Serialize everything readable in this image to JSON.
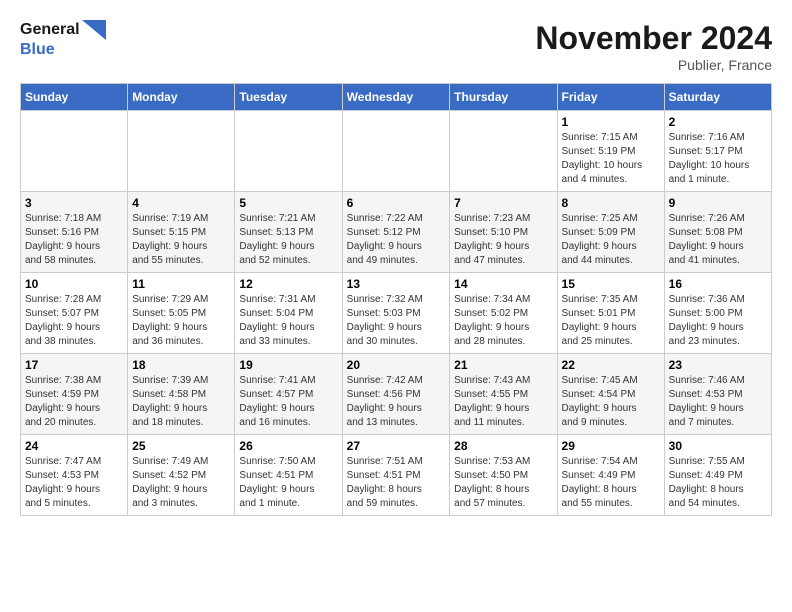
{
  "logo": {
    "line1": "General",
    "line2": "Blue"
  },
  "title": "November 2024",
  "location": "Publier, France",
  "weekdays": [
    "Sunday",
    "Monday",
    "Tuesday",
    "Wednesday",
    "Thursday",
    "Friday",
    "Saturday"
  ],
  "weeks": [
    [
      {
        "day": "",
        "info": ""
      },
      {
        "day": "",
        "info": ""
      },
      {
        "day": "",
        "info": ""
      },
      {
        "day": "",
        "info": ""
      },
      {
        "day": "",
        "info": ""
      },
      {
        "day": "1",
        "info": "Sunrise: 7:15 AM\nSunset: 5:19 PM\nDaylight: 10 hours\nand 4 minutes."
      },
      {
        "day": "2",
        "info": "Sunrise: 7:16 AM\nSunset: 5:17 PM\nDaylight: 10 hours\nand 1 minute."
      }
    ],
    [
      {
        "day": "3",
        "info": "Sunrise: 7:18 AM\nSunset: 5:16 PM\nDaylight: 9 hours\nand 58 minutes."
      },
      {
        "day": "4",
        "info": "Sunrise: 7:19 AM\nSunset: 5:15 PM\nDaylight: 9 hours\nand 55 minutes."
      },
      {
        "day": "5",
        "info": "Sunrise: 7:21 AM\nSunset: 5:13 PM\nDaylight: 9 hours\nand 52 minutes."
      },
      {
        "day": "6",
        "info": "Sunrise: 7:22 AM\nSunset: 5:12 PM\nDaylight: 9 hours\nand 49 minutes."
      },
      {
        "day": "7",
        "info": "Sunrise: 7:23 AM\nSunset: 5:10 PM\nDaylight: 9 hours\nand 47 minutes."
      },
      {
        "day": "8",
        "info": "Sunrise: 7:25 AM\nSunset: 5:09 PM\nDaylight: 9 hours\nand 44 minutes."
      },
      {
        "day": "9",
        "info": "Sunrise: 7:26 AM\nSunset: 5:08 PM\nDaylight: 9 hours\nand 41 minutes."
      }
    ],
    [
      {
        "day": "10",
        "info": "Sunrise: 7:28 AM\nSunset: 5:07 PM\nDaylight: 9 hours\nand 38 minutes."
      },
      {
        "day": "11",
        "info": "Sunrise: 7:29 AM\nSunset: 5:05 PM\nDaylight: 9 hours\nand 36 minutes."
      },
      {
        "day": "12",
        "info": "Sunrise: 7:31 AM\nSunset: 5:04 PM\nDaylight: 9 hours\nand 33 minutes."
      },
      {
        "day": "13",
        "info": "Sunrise: 7:32 AM\nSunset: 5:03 PM\nDaylight: 9 hours\nand 30 minutes."
      },
      {
        "day": "14",
        "info": "Sunrise: 7:34 AM\nSunset: 5:02 PM\nDaylight: 9 hours\nand 28 minutes."
      },
      {
        "day": "15",
        "info": "Sunrise: 7:35 AM\nSunset: 5:01 PM\nDaylight: 9 hours\nand 25 minutes."
      },
      {
        "day": "16",
        "info": "Sunrise: 7:36 AM\nSunset: 5:00 PM\nDaylight: 9 hours\nand 23 minutes."
      }
    ],
    [
      {
        "day": "17",
        "info": "Sunrise: 7:38 AM\nSunset: 4:59 PM\nDaylight: 9 hours\nand 20 minutes."
      },
      {
        "day": "18",
        "info": "Sunrise: 7:39 AM\nSunset: 4:58 PM\nDaylight: 9 hours\nand 18 minutes."
      },
      {
        "day": "19",
        "info": "Sunrise: 7:41 AM\nSunset: 4:57 PM\nDaylight: 9 hours\nand 16 minutes."
      },
      {
        "day": "20",
        "info": "Sunrise: 7:42 AM\nSunset: 4:56 PM\nDaylight: 9 hours\nand 13 minutes."
      },
      {
        "day": "21",
        "info": "Sunrise: 7:43 AM\nSunset: 4:55 PM\nDaylight: 9 hours\nand 11 minutes."
      },
      {
        "day": "22",
        "info": "Sunrise: 7:45 AM\nSunset: 4:54 PM\nDaylight: 9 hours\nand 9 minutes."
      },
      {
        "day": "23",
        "info": "Sunrise: 7:46 AM\nSunset: 4:53 PM\nDaylight: 9 hours\nand 7 minutes."
      }
    ],
    [
      {
        "day": "24",
        "info": "Sunrise: 7:47 AM\nSunset: 4:53 PM\nDaylight: 9 hours\nand 5 minutes."
      },
      {
        "day": "25",
        "info": "Sunrise: 7:49 AM\nSunset: 4:52 PM\nDaylight: 9 hours\nand 3 minutes."
      },
      {
        "day": "26",
        "info": "Sunrise: 7:50 AM\nSunset: 4:51 PM\nDaylight: 9 hours\nand 1 minute."
      },
      {
        "day": "27",
        "info": "Sunrise: 7:51 AM\nSunset: 4:51 PM\nDaylight: 8 hours\nand 59 minutes."
      },
      {
        "day": "28",
        "info": "Sunrise: 7:53 AM\nSunset: 4:50 PM\nDaylight: 8 hours\nand 57 minutes."
      },
      {
        "day": "29",
        "info": "Sunrise: 7:54 AM\nSunset: 4:49 PM\nDaylight: 8 hours\nand 55 minutes."
      },
      {
        "day": "30",
        "info": "Sunrise: 7:55 AM\nSunset: 4:49 PM\nDaylight: 8 hours\nand 54 minutes."
      }
    ]
  ]
}
